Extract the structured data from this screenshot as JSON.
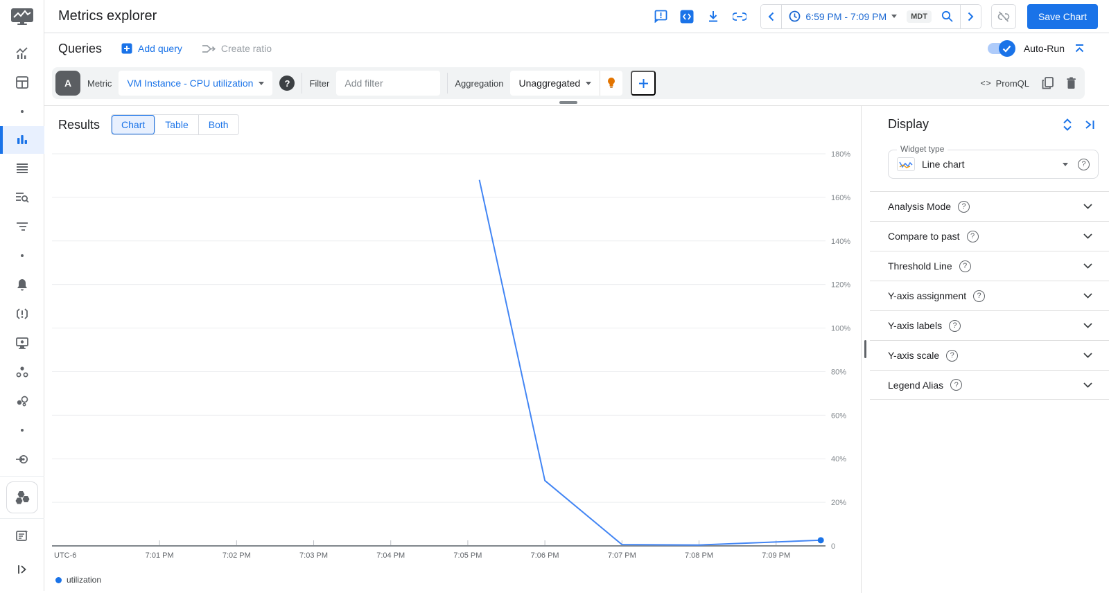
{
  "header": {
    "title": "Metrics explorer",
    "time_range": "6:59 PM - 7:09 PM",
    "timezone": "MDT",
    "save_button": "Save Chart"
  },
  "queries": {
    "title": "Queries",
    "add_query": "Add query",
    "create_ratio": "Create ratio",
    "auto_run": "Auto-Run"
  },
  "query_builder": {
    "query_letter": "A",
    "metric_label": "Metric",
    "metric_value": "VM Instance - CPU utilization",
    "filter_label": "Filter",
    "filter_placeholder": "Add filter",
    "aggregation_label": "Aggregation",
    "aggregation_value": "Unaggregated",
    "promql_label": "PromQL"
  },
  "results": {
    "title": "Results",
    "tabs": [
      "Chart",
      "Table",
      "Both"
    ],
    "active_tab": "Chart"
  },
  "display_panel": {
    "title": "Display",
    "widget_type_label": "Widget type",
    "widget_type_value": "Line chart",
    "sections": [
      "Analysis Mode",
      "Compare to past",
      "Threshold Line",
      "Y-axis assignment",
      "Y-axis labels",
      "Y-axis scale",
      "Legend Alias"
    ]
  },
  "icons": {
    "help_glyph": "?",
    "code_glyph": "<>",
    "feedback_glyph": "!"
  },
  "sidebar": {
    "icons": [
      "monitoring-logo",
      "metrics-overview",
      "dashboards",
      "dot",
      "metrics-explorer",
      "logs",
      "logs-explorer",
      "trace",
      "dot",
      "alerting",
      "error-reporting",
      "uptime-checks",
      "services",
      "integrations",
      "dot",
      "probes",
      "gke-clusters",
      "release-notes",
      "expand-panel"
    ]
  },
  "chart_data": {
    "type": "line",
    "title": "",
    "xlabel": "",
    "ylabel": "",
    "x_axis": {
      "ticks": [
        "7:01 PM",
        "7:02 PM",
        "7:03 PM",
        "7:04 PM",
        "7:05 PM",
        "7:06 PM",
        "7:07 PM",
        "7:08 PM",
        "7:09 PM"
      ],
      "tick_minutes": [
        1,
        2,
        3,
        4,
        5,
        6,
        7,
        8,
        9
      ],
      "utc_label": "UTC-6"
    },
    "y_axis": {
      "ticks_pct": [
        20,
        40,
        60,
        80,
        100,
        120,
        140,
        160,
        180
      ],
      "zero_label": "0",
      "unit": "%",
      "range": [
        0,
        190
      ]
    },
    "series": [
      {
        "name": "utilization",
        "color": "#4285f4",
        "point_color": "#1a73e8",
        "points_time_pct": [
          [
            5.15,
            168
          ],
          [
            6.0,
            30
          ],
          [
            7.0,
            0.6
          ],
          [
            8.0,
            0.4
          ],
          [
            9.58,
            2.6
          ]
        ]
      }
    ],
    "grid": true,
    "legend_position": "bottom-left"
  }
}
